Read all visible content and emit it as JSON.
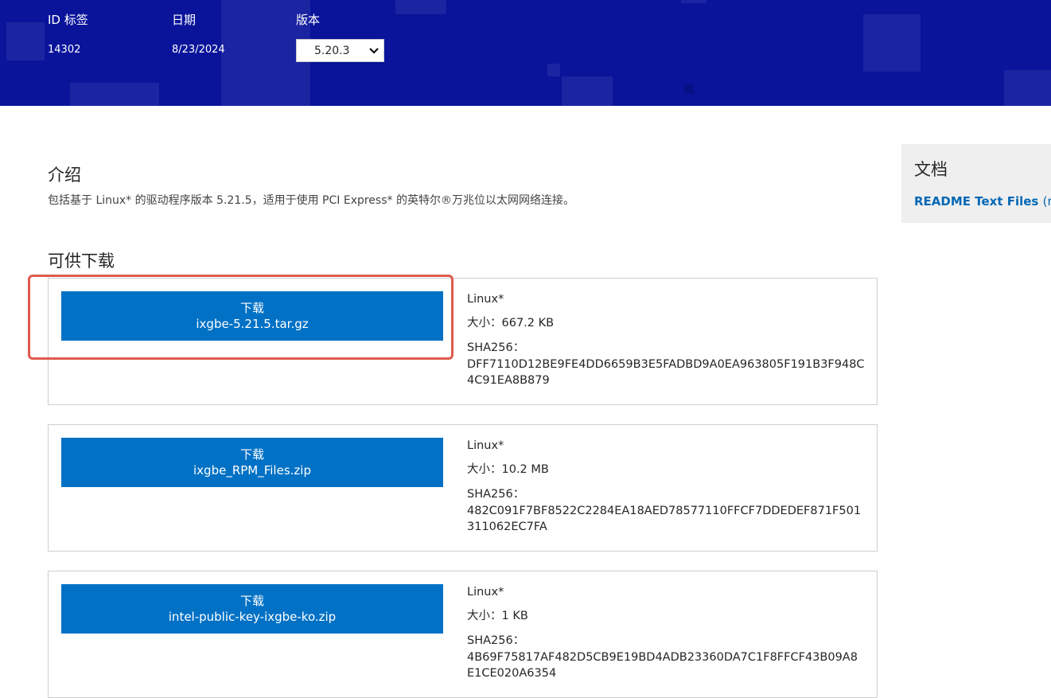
{
  "meta": {
    "id_label": "ID 标签",
    "id_value": "14302",
    "date_label": "日期",
    "date_value": "8/23/2024",
    "version_label": "版本",
    "version_value": "5.20.3"
  },
  "intro": {
    "title": "介绍",
    "text": "包括基于 Linux* 的驱动程序版本 5.21.5，适用于使用 PCI Express* 的英特尔®万兆位以太网网络连接。"
  },
  "downloads": {
    "title": "可供下载",
    "items": [
      {
        "button_label": "下载",
        "file_name": "ixgbe-5.21.5.tar.gz",
        "os": "Linux*",
        "size": "大小：667.2 KB",
        "sha_label": "SHA256：",
        "sha": "DFF7110D12BE9FE4DD6659B3E5FADBD9A0EA963805F191B3F948C4C91EA8B879"
      },
      {
        "button_label": "下载",
        "file_name": "ixgbe_RPM_Files.zip",
        "os": "Linux*",
        "size": "大小：10.2 MB",
        "sha_label": "SHA256：",
        "sha": "482C091F7BF8522C2284EA18AED78577110FFCF7DDEDEF871F501311062EC7FA"
      },
      {
        "button_label": "下载",
        "file_name": "intel-public-key-ixgbe-ko.zip",
        "os": "Linux*",
        "size": "大小：1 KB",
        "sha_label": "SHA256：",
        "sha": "4B69F75817AF482D5CB9E19BD4ADB23360DA7C1F8FFCF43B09A8E1CE020A6354"
      }
    ]
  },
  "docs": {
    "title": "文档",
    "link_label": "README Text Files",
    "link_suffix": "(read"
  },
  "colors": {
    "banner": "#0a149a",
    "button": "#0071c5",
    "highlight": "#e05a4f",
    "link": "#0068b5"
  },
  "icons": {
    "select_chevron": "chevron-down-icon"
  }
}
